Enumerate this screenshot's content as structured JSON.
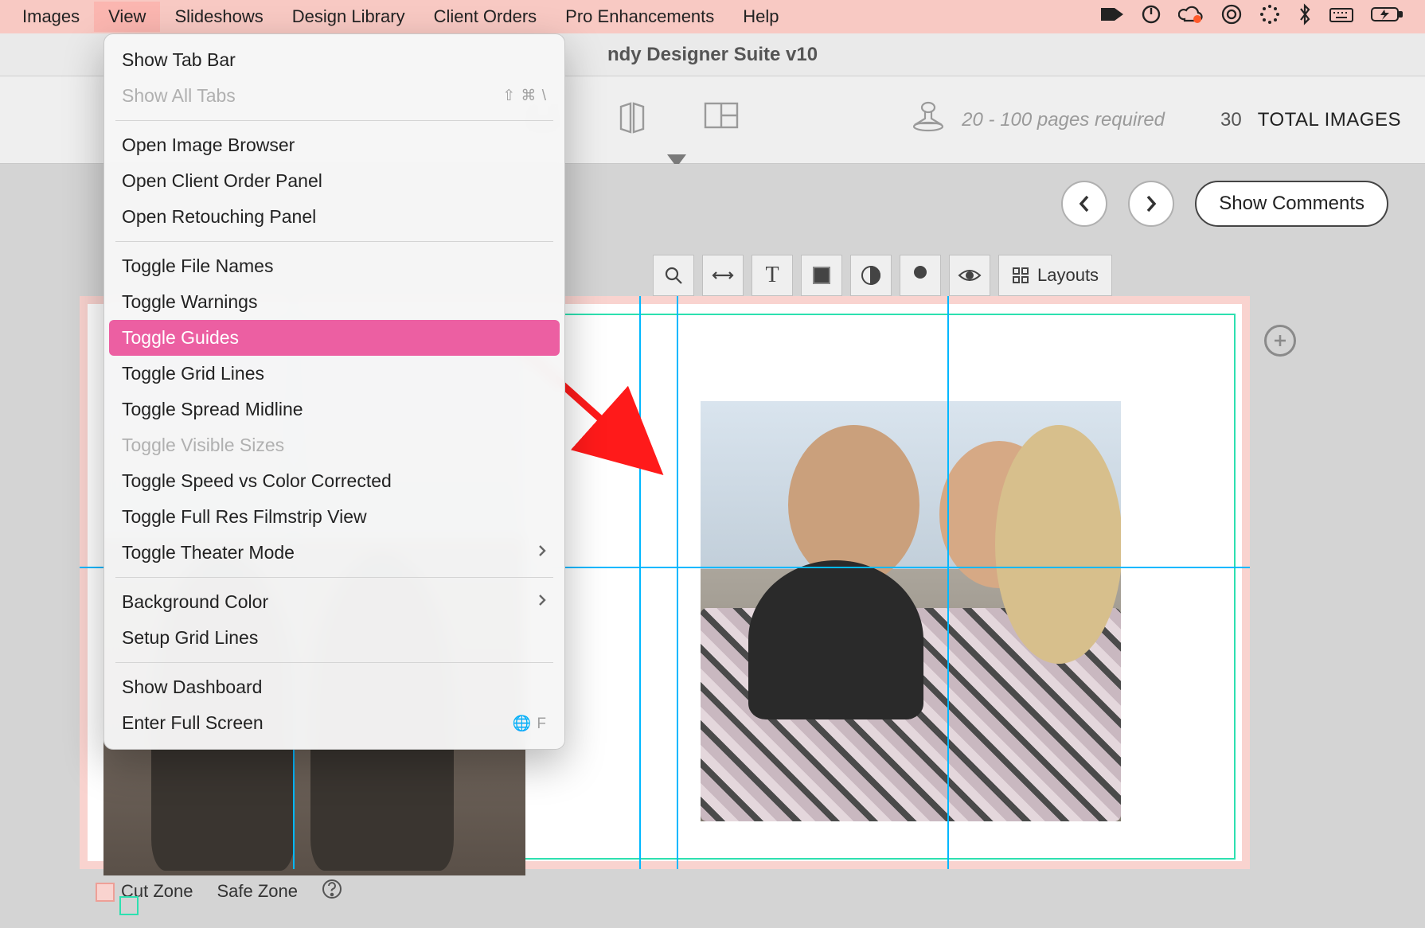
{
  "menubar": {
    "items": [
      "Images",
      "View",
      "Slideshows",
      "Design Library",
      "Client Orders",
      "Pro Enhancements",
      "Help"
    ],
    "open_index": 1
  },
  "window": {
    "title_suffix": "ndy Designer Suite v10"
  },
  "toolbar": {
    "pages_required": "20 - 100 pages required",
    "total_count": "30",
    "total_label": "TOTAL IMAGES"
  },
  "subbar": {
    "show_comments": "Show Comments"
  },
  "canvas_tools": {
    "layouts": "Layouts"
  },
  "legend": {
    "cut": "Cut Zone",
    "safe": "Safe Zone"
  },
  "view_menu": {
    "items": [
      {
        "label": "Show Tab Bar",
        "type": "item"
      },
      {
        "label": "Show All Tabs",
        "type": "item",
        "disabled": true,
        "shortcut": "⇧ ⌘ \\"
      },
      {
        "type": "sep"
      },
      {
        "label": "Open Image Browser",
        "type": "item"
      },
      {
        "label": "Open Client Order Panel",
        "type": "item"
      },
      {
        "label": "Open Retouching Panel",
        "type": "item"
      },
      {
        "type": "sep"
      },
      {
        "label": "Toggle File Names",
        "type": "item"
      },
      {
        "label": "Toggle Warnings",
        "type": "item"
      },
      {
        "label": "Toggle Guides",
        "type": "item",
        "highlight": true
      },
      {
        "label": "Toggle Grid Lines",
        "type": "item"
      },
      {
        "label": "Toggle Spread Midline",
        "type": "item"
      },
      {
        "label": "Toggle Visible Sizes",
        "type": "item",
        "disabled": true
      },
      {
        "label": "Toggle Speed vs Color Corrected",
        "type": "item"
      },
      {
        "label": "Toggle Full Res Filmstrip View",
        "type": "item"
      },
      {
        "label": "Toggle Theater Mode",
        "type": "item",
        "submenu": true
      },
      {
        "type": "sep"
      },
      {
        "label": "Background Color",
        "type": "item",
        "submenu": true
      },
      {
        "label": "Setup Grid Lines",
        "type": "item"
      },
      {
        "type": "sep"
      },
      {
        "label": "Show Dashboard",
        "type": "item"
      },
      {
        "label": "Enter Full Screen",
        "type": "item",
        "shortcut": "🌐 F"
      }
    ]
  }
}
